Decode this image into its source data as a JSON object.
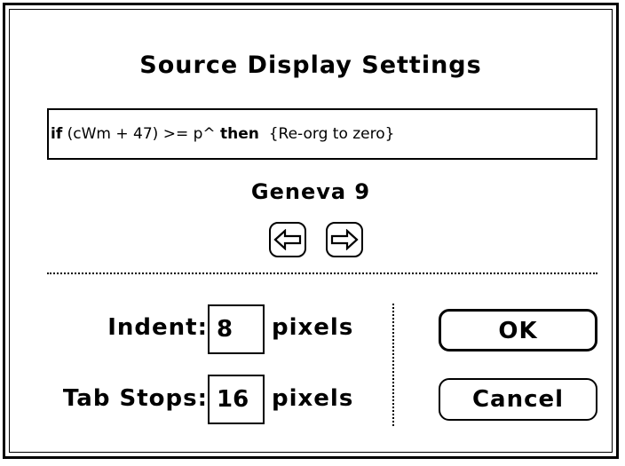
{
  "dialog": {
    "title": "Source Display Settings",
    "preview": {
      "kw_if": "if",
      "expr": " (cWm + 47) >= p^ ",
      "kw_then": "then",
      "comment": "  {Re-org to zero}"
    },
    "font_name": "Geneva 9",
    "indent": {
      "label": "Indent:",
      "value": "8",
      "unit": "pixels"
    },
    "tab_stops": {
      "label": "Tab Stops:",
      "value": "16",
      "unit": "pixels"
    },
    "ok_label": "OK",
    "cancel_label": "Cancel",
    "icons": {
      "prev": "arrow-left-icon",
      "next": "arrow-right-icon"
    }
  }
}
